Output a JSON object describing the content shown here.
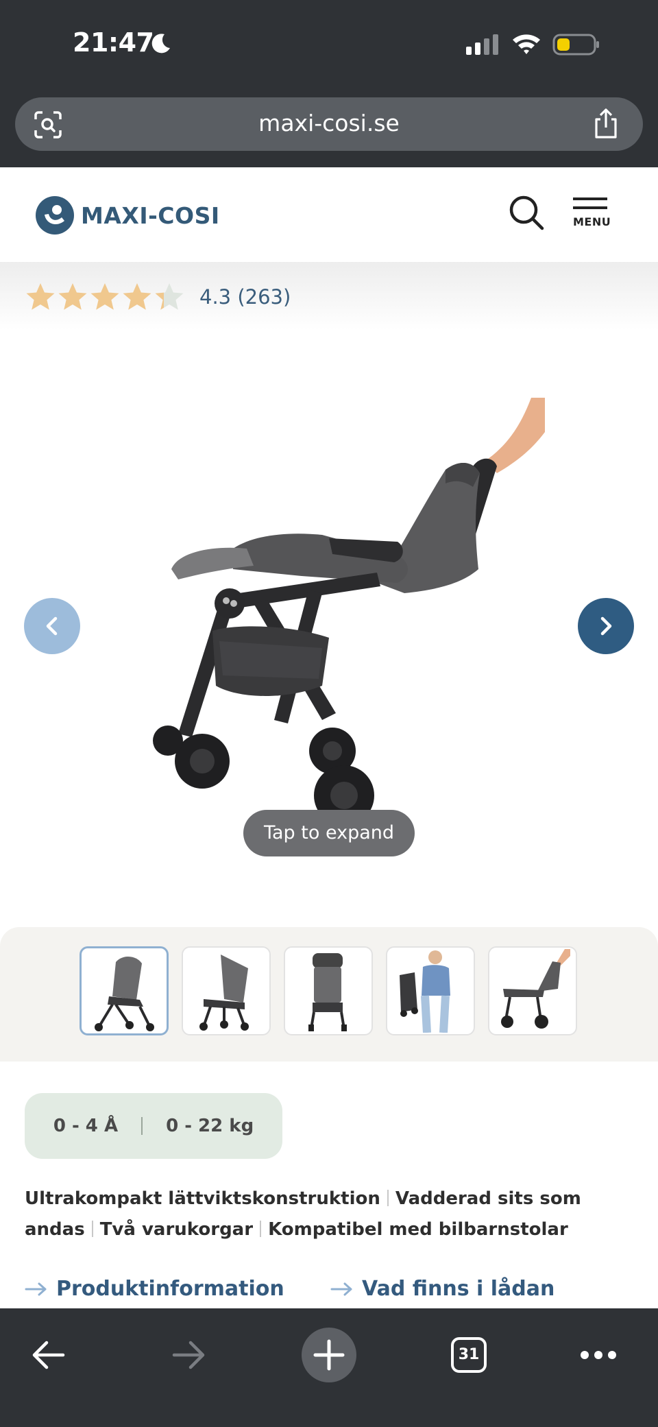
{
  "status_bar": {
    "time": "21:47"
  },
  "browser": {
    "url": "maxi-cosi.se",
    "tab_count": "31"
  },
  "site": {
    "logo_text": "MAXI-COSI",
    "menu_label": "MENU",
    "brand_color": "#345a78"
  },
  "product": {
    "rating_value": 4.3,
    "rating_text": "4.3 (263)",
    "gallery_button": "Tap to expand",
    "thumbnails": [
      "stroller-front-angle",
      "stroller-side-angle",
      "stroller-front",
      "stroller-carried-by-woman",
      "stroller-being-folded"
    ],
    "age_range": "0 - 4 Å",
    "weight_range": "0 - 22 kg",
    "features": [
      "Ultrakompakt lättviktskonstruktion",
      "Vadderad sits som andas",
      "Två varukorgar",
      "Kompatibel med bilbarnstolar"
    ],
    "links": [
      "Produktinformation",
      "Vad finns i lådan"
    ]
  },
  "colors": {
    "chrome": "#2f3236",
    "accent": "#2f5c82",
    "chip_bg": "#e2ebe3",
    "star": "#f0c88e"
  }
}
